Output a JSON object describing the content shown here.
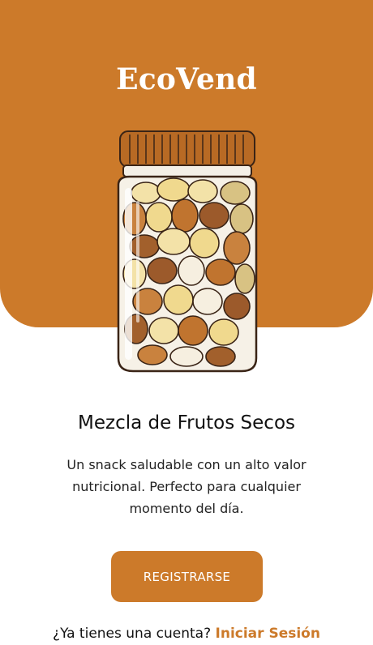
{
  "app": {
    "brand": "EcoVend"
  },
  "product": {
    "title": "Mezcla de Frutos Secos",
    "description": "Un snack saludable con un alto valor nutricional. Perfecto para cualquier momento del día."
  },
  "actions": {
    "register_label": "REGISTRARSE",
    "have_account_text": "¿Ya tienes una cuenta?",
    "login_link": "Iniciar Sesión"
  },
  "illustration": {
    "icon": "mixed-nuts-jar-icon"
  },
  "colors": {
    "brand": "#cc7a2a",
    "background": "#ffffff",
    "text": "#111111"
  }
}
